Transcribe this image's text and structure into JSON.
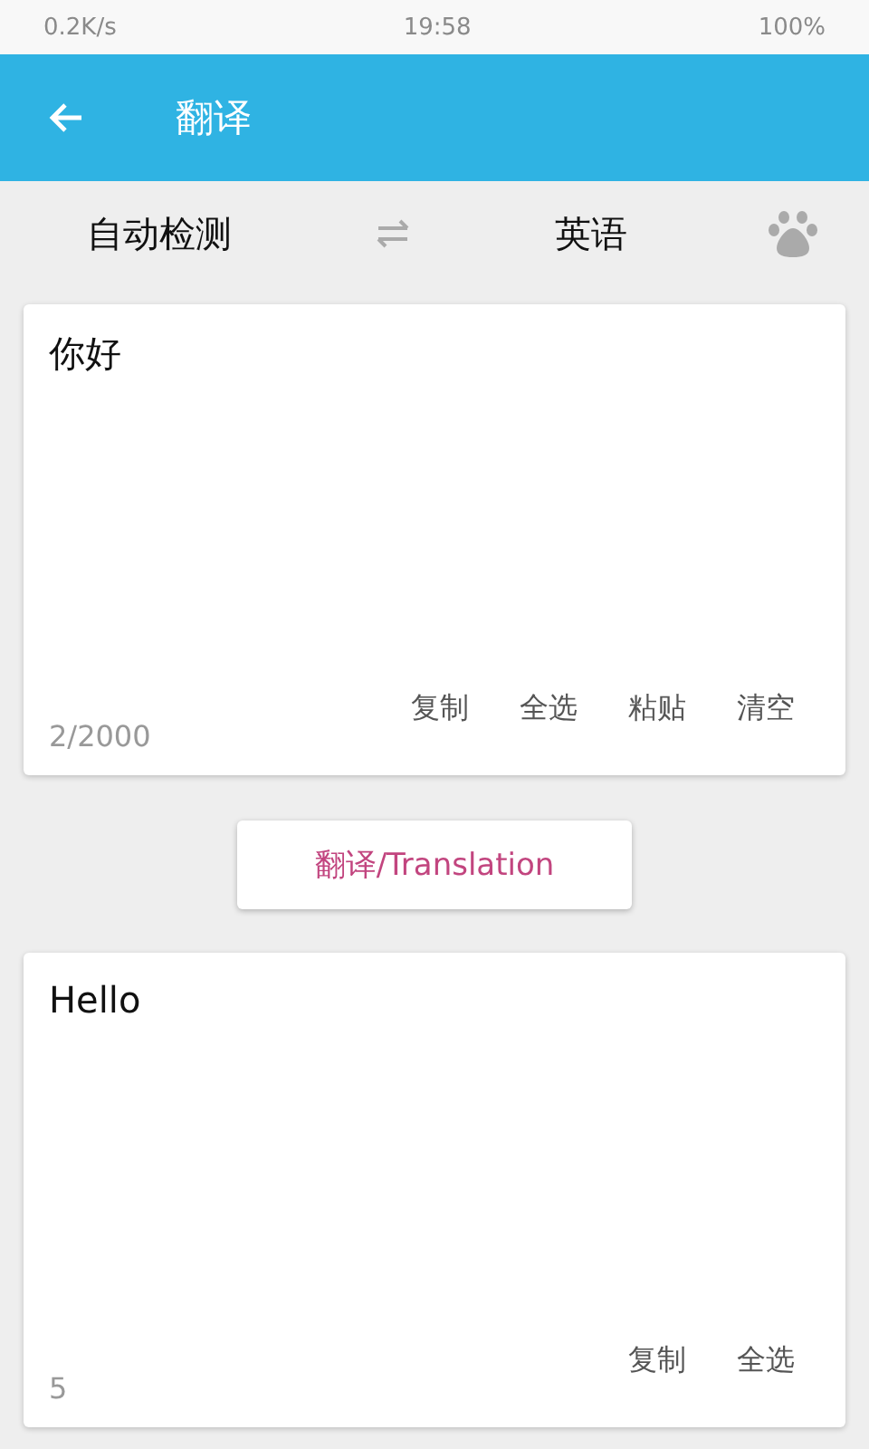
{
  "status_bar": {
    "network_speed": "0.2K/s",
    "time": "19:58",
    "battery": "100%"
  },
  "header": {
    "title": "翻译"
  },
  "languages": {
    "source": "自动检测",
    "target": "英语"
  },
  "input": {
    "text": "你好",
    "count": "2/2000",
    "actions": [
      "复制",
      "全选",
      "粘贴",
      "清空"
    ]
  },
  "translate_button": "翻译/Translation",
  "output": {
    "text": "Hello",
    "count": "5",
    "actions": [
      "复制",
      "全选"
    ]
  }
}
